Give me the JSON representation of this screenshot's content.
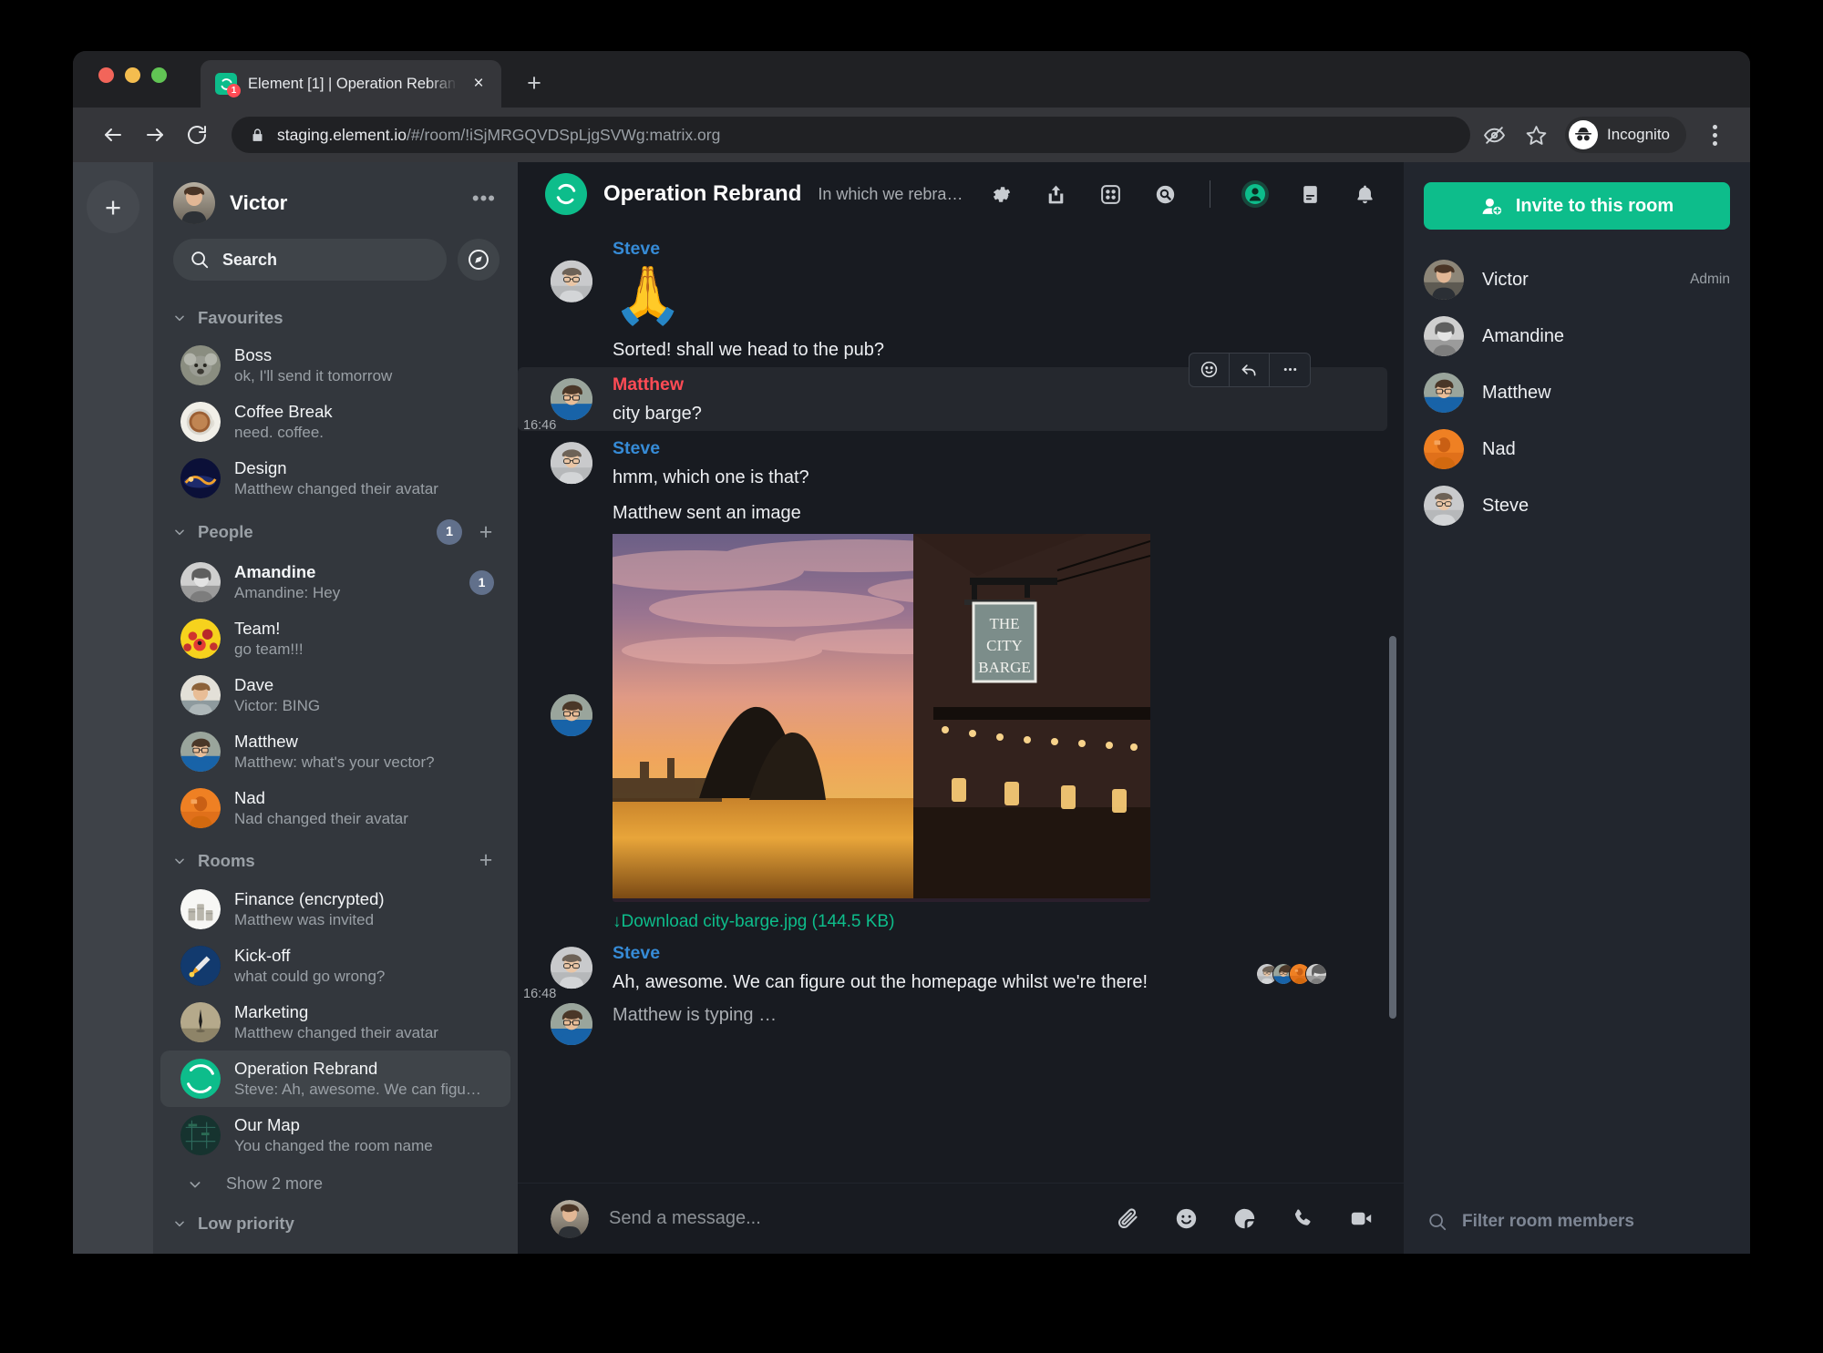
{
  "browser": {
    "tab": {
      "title": "Element [1] | Operation Rebran",
      "badge": "1",
      "favicon_name": "element-logo-icon",
      "close_label": "×"
    },
    "new_tab_label": "+",
    "toolbar": {
      "back_label": "back-arrow",
      "forward_label": "forward-arrow",
      "reload_label": "reload",
      "url_host": "staging.element.io",
      "url_path": "/#/room/!iSjMRGQVDSpLjgSVWg:matrix.org",
      "incognito_label": "Incognito"
    }
  },
  "spaces": {
    "add_label": "+"
  },
  "sidebar": {
    "user": {
      "name": "Victor",
      "menu_label": "•••"
    },
    "search": {
      "placeholder": "Search"
    },
    "sections": [
      {
        "title": "Favourites",
        "badge": "",
        "has_add": false,
        "rooms": [
          {
            "name": "Boss",
            "preview": "ok, I'll send it tomorrow",
            "unread": "",
            "avatar": "boss",
            "bold": false
          },
          {
            "name": "Coffee Break",
            "preview": "need. coffee.",
            "unread": "",
            "avatar": "coffee",
            "bold": false
          },
          {
            "name": "Design",
            "preview": "Matthew changed their avatar",
            "unread": "",
            "avatar": "design",
            "bold": false
          }
        ]
      },
      {
        "title": "People",
        "badge": "1",
        "has_add": true,
        "rooms": [
          {
            "name": "Amandine",
            "preview": "Amandine: Hey",
            "unread": "1",
            "avatar": "amandine",
            "bold": true
          },
          {
            "name": "Team!",
            "preview": "go team!!!",
            "unread": "",
            "avatar": "team",
            "bold": false
          },
          {
            "name": "Dave",
            "preview": "Victor: BING",
            "unread": "",
            "avatar": "dave",
            "bold": false
          },
          {
            "name": "Matthew",
            "preview": "Matthew: what's your vector?",
            "unread": "",
            "avatar": "matthew",
            "bold": false
          },
          {
            "name": "Nad",
            "preview": "Nad changed their avatar",
            "unread": "",
            "avatar": "nad",
            "bold": false
          }
        ]
      },
      {
        "title": "Rooms",
        "badge": "",
        "has_add": true,
        "rooms": [
          {
            "name": "Finance (encrypted)",
            "preview": "Matthew was invited",
            "unread": "",
            "avatar": "finance",
            "bold": false
          },
          {
            "name": "Kick-off",
            "preview": "what could go wrong?",
            "unread": "",
            "avatar": "kickoff",
            "bold": false
          },
          {
            "name": "Marketing",
            "preview": "Matthew changed their avatar",
            "unread": "",
            "avatar": "marketing",
            "bold": false
          },
          {
            "name": "Operation Rebrand",
            "preview": "Steve: Ah, awesome. We can figu…",
            "unread": "",
            "avatar": "element",
            "bold": false,
            "selected": true
          },
          {
            "name": "Our Map",
            "preview": "You changed the room name",
            "unread": "",
            "avatar": "map",
            "bold": false
          }
        ],
        "show_more": "Show 2 more"
      },
      {
        "title": "Low priority",
        "badge": "",
        "has_add": false,
        "rooms": []
      }
    ]
  },
  "room": {
    "name": "Operation Rebrand",
    "topic": "In which we rebrand Riot to Element",
    "header_icons": [
      "settings-gear-icon",
      "share-room-icon",
      "apps-widgets-icon",
      "search-room-icon",
      "room-members-icon",
      "room-notes-icon",
      "notifications-bell-icon"
    ],
    "timeline": [
      {
        "id": "ev1",
        "sender": "Steve",
        "sender_color": "steve",
        "type": "emoji",
        "body": "🙏",
        "time": ""
      },
      {
        "id": "ev2",
        "sender": "",
        "sender_color": "steve",
        "type": "text",
        "body": "Sorted! shall we head to the pub?",
        "time": ""
      },
      {
        "id": "ev3",
        "sender": "Matthew",
        "sender_color": "matthew",
        "type": "text",
        "body": "city barge?",
        "time": "16:46",
        "highlighted": true
      },
      {
        "id": "ev4",
        "sender": "Steve",
        "sender_color": "steve",
        "type": "text",
        "body": "hmm, which one is that?",
        "time": ""
      },
      {
        "id": "ev5",
        "sender": "",
        "sender_color": "matthew",
        "type": "image",
        "body": "Matthew sent an image",
        "download": "↓Download city-barge.jpg (144.5 KB)",
        "time": ""
      },
      {
        "id": "ev6",
        "sender": "Steve",
        "sender_color": "steve",
        "type": "text",
        "body": "Ah, awesome. We can figure out the homepage whilst we're there!",
        "time": "16:48"
      },
      {
        "id": "ev7",
        "sender": "",
        "sender_color": "",
        "type": "typing",
        "body": "Matthew is typing …",
        "time": ""
      }
    ],
    "action_bar": [
      "react-emoji-icon",
      "reply-icon",
      "more-options-icon"
    ],
    "composer": {
      "placeholder": "Send a message...",
      "icons": [
        "attachment-icon",
        "emoji-icon",
        "sticker-icon",
        "voice-call-icon",
        "video-call-icon"
      ]
    }
  },
  "right_panel": {
    "invite_label": "Invite to this room",
    "members": [
      {
        "name": "Victor",
        "power": "Admin",
        "avatar": "victor"
      },
      {
        "name": "Amandine",
        "power": "",
        "avatar": "amandine"
      },
      {
        "name": "Matthew",
        "power": "",
        "avatar": "matthew"
      },
      {
        "name": "Nad",
        "power": "",
        "avatar": "nad"
      },
      {
        "name": "Steve",
        "power": "",
        "avatar": "steve"
      }
    ],
    "filter_placeholder": "Filter room members"
  },
  "colors": {
    "accent_green": "#0dbd8b",
    "sender_blue": "#368bd6",
    "sender_pink": "#ff4b55",
    "badge_blue": "#61708b",
    "timeline_bg": "#181b21",
    "sidebar_bg": "#33373d",
    "right_panel_bg": "#22262e"
  }
}
